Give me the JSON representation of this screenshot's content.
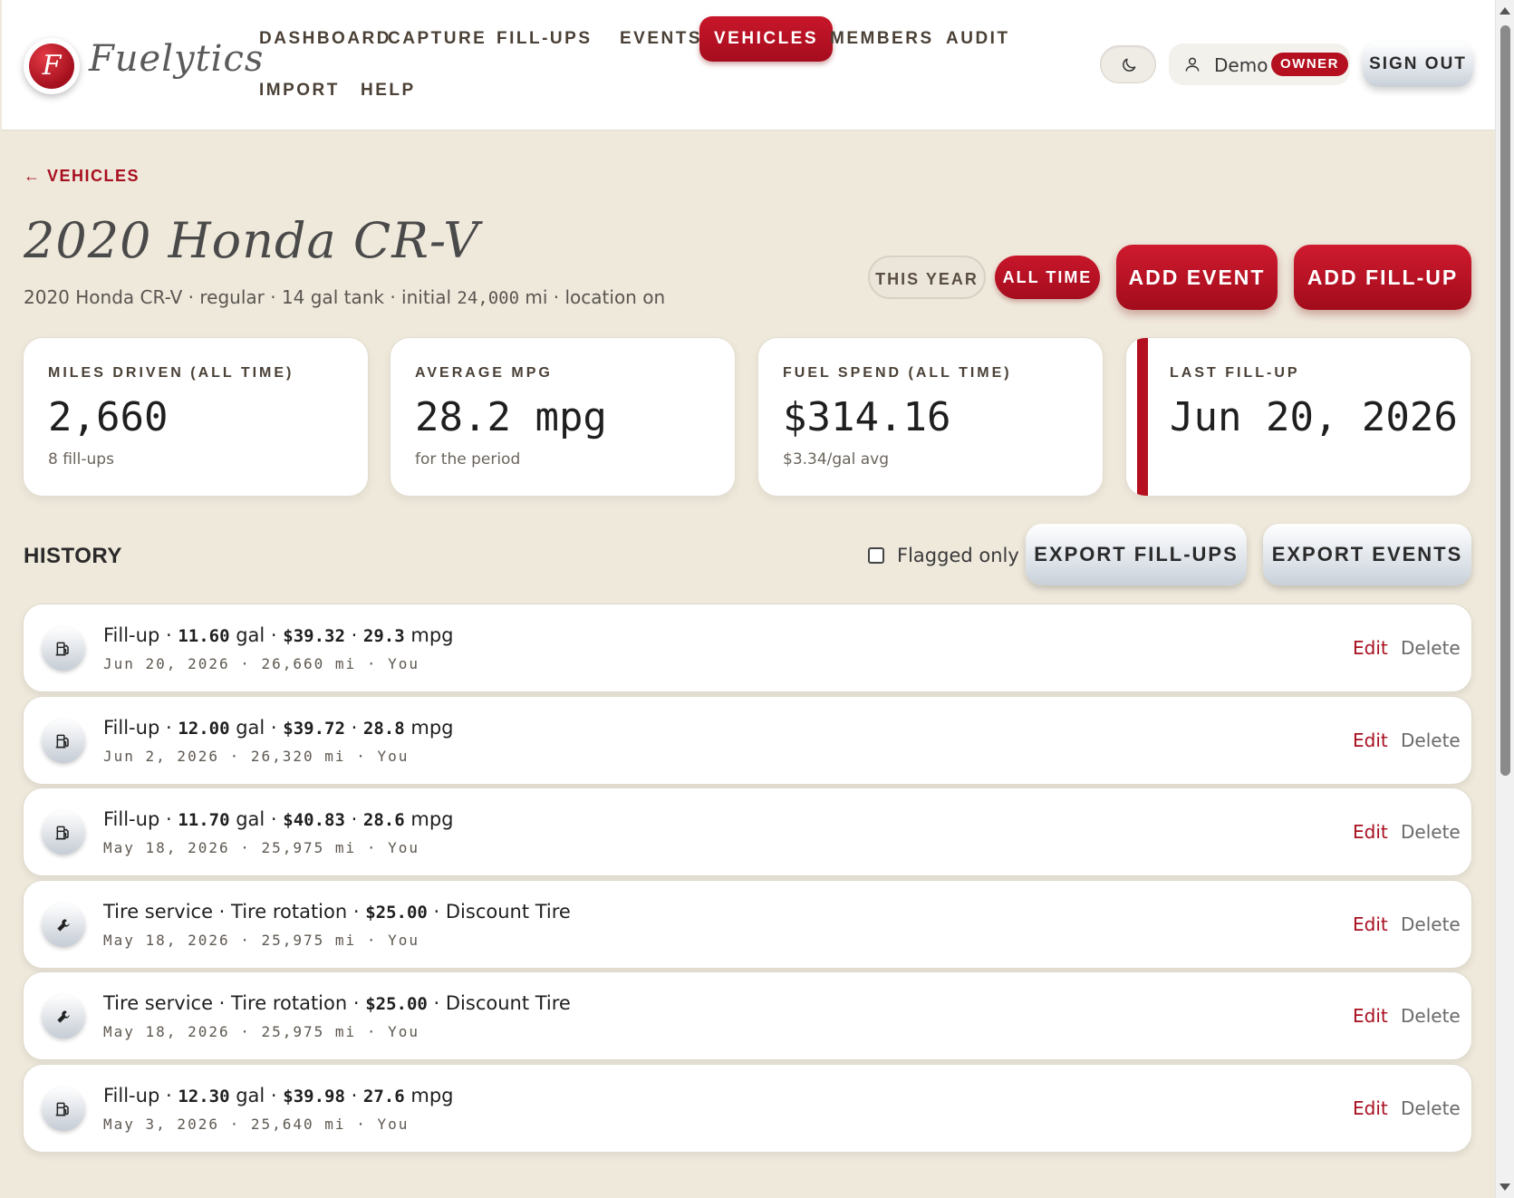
{
  "app": {
    "logo_letter": "F",
    "name": "Fuelytics"
  },
  "nav": {
    "items": [
      {
        "label": "DASHBOARD"
      },
      {
        "label": "CAPTURE"
      },
      {
        "label": "FILL-UPS"
      },
      {
        "label": "EVENTS"
      },
      {
        "label": "VEHICLES",
        "active": true
      },
      {
        "label": "MEMBERS"
      },
      {
        "label": "AUDIT"
      },
      {
        "label": "IMPORT"
      },
      {
        "label": "HELP"
      }
    ]
  },
  "user": {
    "name": "Demo",
    "role": "OWNER",
    "sign_out_label": "SIGN OUT",
    "theme_icon": "moon-icon"
  },
  "page": {
    "back_label": "← VEHICLES",
    "title": "2020 Honda CR-V",
    "subtitle_pre": "2020 Honda CR-V · regular · 14 gal tank · initial ",
    "subtitle_odometer": "24,000",
    "subtitle_post": " mi · location on",
    "range_options": [
      "THIS YEAR",
      "ALL TIME"
    ],
    "range_selected": "ALL TIME",
    "add_event_label": "ADD EVENT",
    "add_fillup_label": "ADD FILL-UP"
  },
  "stats": [
    {
      "label": "MILES DRIVEN (ALL TIME)",
      "value": "2,660",
      "sub": "8 fill-ups"
    },
    {
      "label": "AVERAGE MPG",
      "value": "28.2 mpg",
      "sub": "for the period"
    },
    {
      "label": "FUEL SPEND (ALL TIME)",
      "value": "$314.16",
      "sub": "$3.34/gal avg"
    },
    {
      "label": "LAST FILL-UP",
      "value": "Jun 20, 2026",
      "sub": ""
    }
  ],
  "history": {
    "title": "HISTORY",
    "flagged_only_label": "Flagged only",
    "flagged_only_checked": false,
    "export_fillups_label": "EXPORT FILL-UPS",
    "export_events_label": "EXPORT EVENTS",
    "edit_label": "Edit",
    "delete_label": "Delete",
    "rows": [
      {
        "kind": "fillup",
        "icon": "fuel-pump-icon",
        "prefix": "Fill-up · ",
        "a": "11.60",
        "a_unit": " gal · ",
        "b": "$39.32",
        "sep": " · ",
        "c": "29.3",
        "suffix": " mpg",
        "meta": "Jun 20, 2026 · 26,660 mi · You"
      },
      {
        "kind": "fillup",
        "icon": "fuel-pump-icon",
        "prefix": "Fill-up · ",
        "a": "12.00",
        "a_unit": " gal · ",
        "b": "$39.72",
        "sep": " · ",
        "c": "28.8",
        "suffix": " mpg",
        "meta": "Jun 2, 2026 · 26,320 mi · You"
      },
      {
        "kind": "fillup",
        "icon": "fuel-pump-icon",
        "prefix": "Fill-up · ",
        "a": "11.70",
        "a_unit": " gal · ",
        "b": "$40.83",
        "sep": " · ",
        "c": "28.6",
        "suffix": " mpg",
        "meta": "May 18, 2026 · 25,975 mi · You"
      },
      {
        "kind": "event",
        "icon": "wrench-icon",
        "prefix": "Tire service · Tire rotation · ",
        "b": "$25.00",
        "suffix": " · Discount Tire",
        "meta": "May 18, 2026 · 25,975 mi · You"
      },
      {
        "kind": "event",
        "icon": "wrench-icon",
        "prefix": "Tire service · Tire rotation · ",
        "b": "$25.00",
        "suffix": " · Discount Tire",
        "meta": "May 18, 2026 · 25,975 mi · You"
      },
      {
        "kind": "fillup",
        "icon": "fuel-pump-icon",
        "prefix": "Fill-up · ",
        "a": "12.30",
        "a_unit": " gal · ",
        "b": "$39.98",
        "sep": " · ",
        "c": "27.6",
        "suffix": " mpg",
        "meta": "May 3, 2026 · 25,640 mi · You"
      }
    ]
  },
  "colors": {
    "accent": "#b4101f",
    "background": "#efe9dc",
    "card": "#ffffff"
  }
}
